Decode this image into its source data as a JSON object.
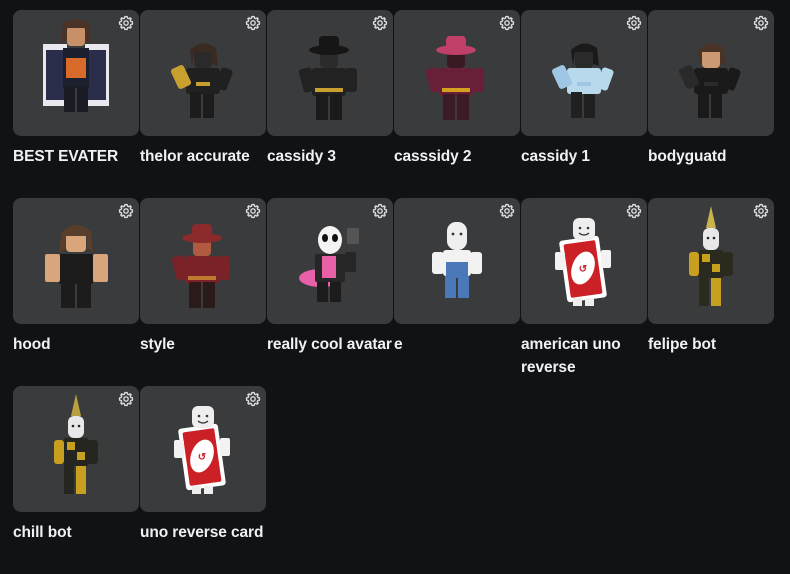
{
  "outfits": [
    {
      "name": "BEST EVATER",
      "figure": "shirt-figure",
      "colors": {
        "hair": "#4a3326",
        "skin": "#c89068",
        "body": "#1c1f2e",
        "accent": "#e8e8ee",
        "legs": "#1a1b24"
      }
    },
    {
      "name": "thelor accurate",
      "figure": "slim-figure",
      "colors": {
        "hair": "#3a2a22",
        "skin": "#2a2a2a",
        "body": "#202020",
        "accent": "#c8a030",
        "legs": "#1c1c1c"
      }
    },
    {
      "name": "cassidy 3",
      "figure": "hat-figure",
      "colors": {
        "hair": "#161616",
        "skin": "#2b2b2b",
        "body": "#222222",
        "accent": "#c8a030",
        "legs": "#1b1b1b"
      }
    },
    {
      "name": "casssidy 2",
      "figure": "hat-figure",
      "colors": {
        "hair": "#c0406a",
        "skin": "#3a1a22",
        "body": "#6a1f38",
        "accent": "#d4a020",
        "legs": "#3c1a26"
      }
    },
    {
      "name": "cassidy 1",
      "figure": "slim-figure",
      "colors": {
        "hair": "#1a1a1a",
        "skin": "#2a2a2a",
        "body": "#b8d8ec",
        "accent": "#9fc6e2",
        "legs": "#202020"
      }
    },
    {
      "name": "bodyguatd",
      "figure": "slim-figure",
      "colors": {
        "hair": "#4a3326",
        "skin": "#cc9a72",
        "body": "#1a1a1a",
        "accent": "#2a2a2a",
        "legs": "#1a1a1a"
      }
    },
    {
      "name": "hood",
      "figure": "wide-figure",
      "colors": {
        "hair": "#5a3e2c",
        "skin": "#d8a67a",
        "body": "#1b1b1b",
        "accent": "#2a2a2a",
        "legs": "#1c1c1c"
      }
    },
    {
      "name": "style",
      "figure": "hat-figure",
      "colors": {
        "hair": "#8a2a2a",
        "skin": "#b05a40",
        "body": "#7a2228",
        "accent": "#c07a30",
        "legs": "#2a1a1a"
      }
    },
    {
      "name": "really cool avatar",
      "figure": "panda-figure",
      "colors": {
        "hair": "#f4f4f4",
        "skin": "#111111",
        "body": "#262626",
        "accent": "#e860a8",
        "legs": "#1c1c1c"
      }
    },
    {
      "name": "e",
      "figure": "overalls-figure",
      "colors": {
        "hair": "#eeeeee",
        "skin": "#efefef",
        "body": "#f2f2f2",
        "accent": "#4a78b8",
        "legs": "#4a78b8"
      }
    },
    {
      "name": "american uno reverse",
      "figure": "card-figure",
      "colors": {
        "hair": "#eeeeee",
        "skin": "#f2f2f2",
        "body": "#cc2027",
        "accent": "#ffffff",
        "legs": "#eeeeee"
      }
    },
    {
      "name": "felipe bot",
      "figure": "bot-figure",
      "colors": {
        "hair": "#c8b44a",
        "skin": "#e8e8e8",
        "body": "#2a2a1e",
        "accent": "#c8a020",
        "legs": "#2a2a1e"
      }
    },
    {
      "name": "chill bot",
      "figure": "bot-figure",
      "colors": {
        "hair": "#b8a040",
        "skin": "#e8e8e8",
        "body": "#262620",
        "accent": "#c8a020",
        "legs": "#262620"
      }
    },
    {
      "name": "uno reverse card",
      "figure": "card-figure",
      "colors": {
        "hair": "#eeeeee",
        "skin": "#f2f2f2",
        "body": "#cc2027",
        "accent": "#ffffff",
        "legs": "#eeeeee"
      }
    }
  ],
  "settings_icon": "gear-icon"
}
